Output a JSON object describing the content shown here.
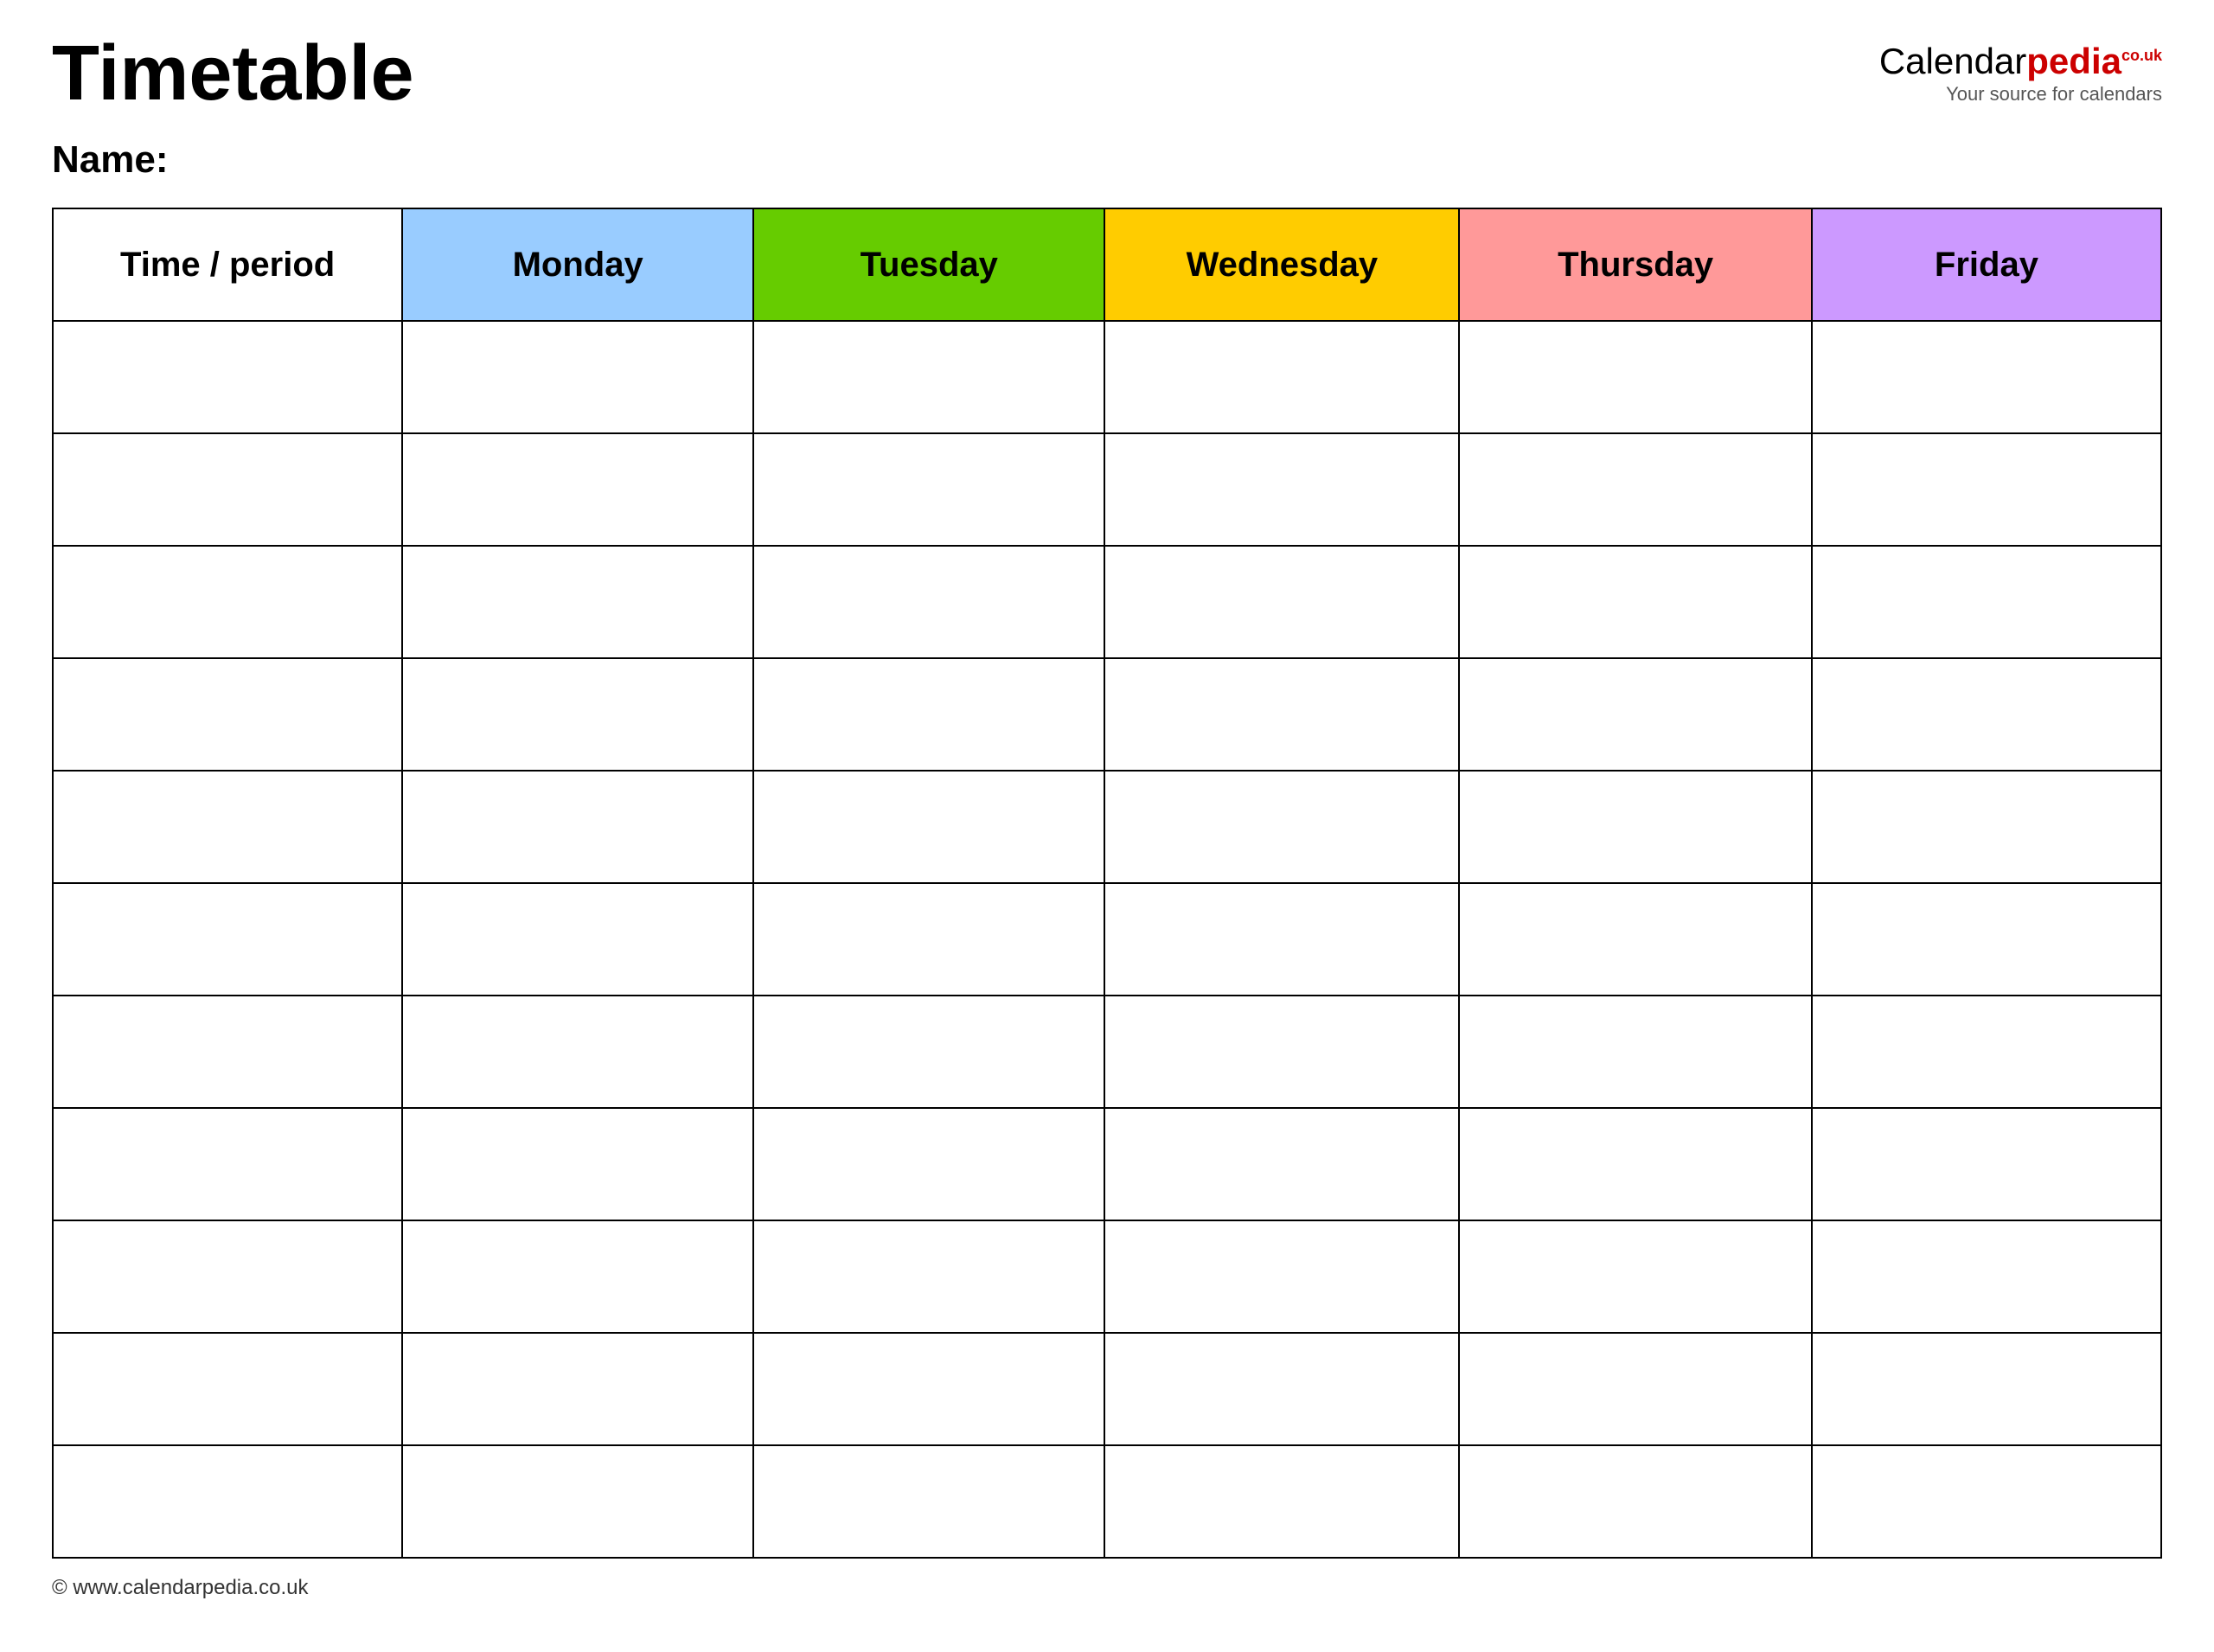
{
  "header": {
    "title": "Timetable",
    "logo": {
      "calendar_text": "Calendar",
      "pedia_text": "pedia",
      "co_uk": "co.uk",
      "tagline": "Your source for calendars"
    }
  },
  "name_label": "Name:",
  "table": {
    "headers": [
      {
        "label": "Time / period",
        "class": "th-time"
      },
      {
        "label": "Monday",
        "class": "th-monday"
      },
      {
        "label": "Tuesday",
        "class": "th-tuesday"
      },
      {
        "label": "Wednesday",
        "class": "th-wednesday"
      },
      {
        "label": "Thursday",
        "class": "th-thursday"
      },
      {
        "label": "Friday",
        "class": "th-friday"
      }
    ],
    "row_count": 11
  },
  "footer": {
    "url": "www.calendarpedia.co.uk"
  }
}
